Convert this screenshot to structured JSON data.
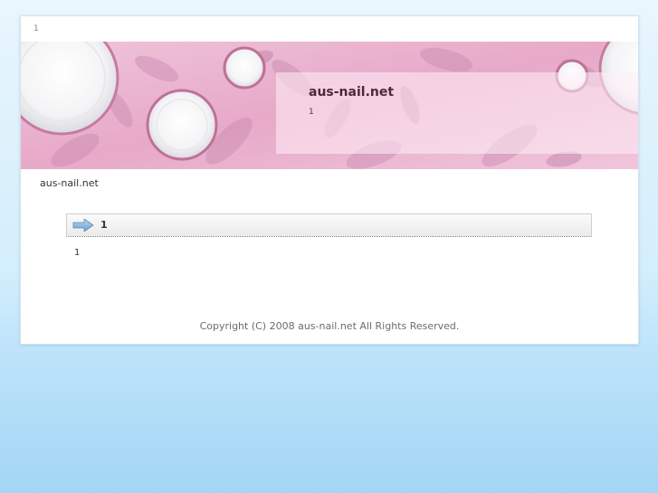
{
  "header": {
    "top_label": "1"
  },
  "banner": {
    "title": "aus-nail.net",
    "subtitle": "1"
  },
  "breadcrumb": {
    "label": "aus-nail.net"
  },
  "section": {
    "title": "1",
    "icon": "arrow-right-icon",
    "body": "1"
  },
  "footer": {
    "copyright": "Copyright (C) 2008 aus-nail.net All Rights Reserved."
  },
  "colors": {
    "background_top": "#e9f6fd",
    "background_bottom": "#a3d6f5",
    "banner_pink": "#e9b1cd",
    "plate_white": "#ffffff",
    "arrow_blue": "#7fb2db"
  }
}
